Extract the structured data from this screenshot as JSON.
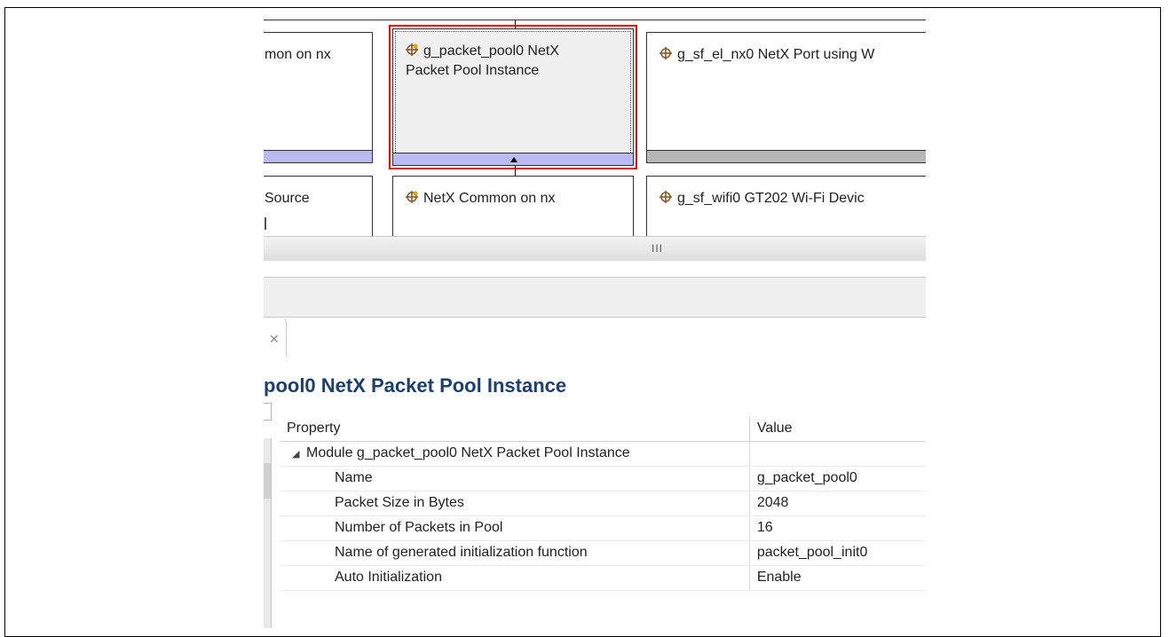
{
  "diagram": {
    "modules": [
      {
        "id": "common-top",
        "label": "mon on nx",
        "icon": "module-icon"
      },
      {
        "id": "packet-pool",
        "label": "g_packet_pool0 NetX\nPacket Pool Instance",
        "icon": "module-warning-icon",
        "selected": true
      },
      {
        "id": "port-nx",
        "label": "g_sf_el_nx0 NetX Port using W",
        "icon": "module-icon"
      },
      {
        "id": "source",
        "label": "Source",
        "icon": "none"
      },
      {
        "id": "common-bottom",
        "label": "NetX Common on nx",
        "icon": "module-warning-icon"
      },
      {
        "id": "wifi",
        "label": "g_sf_wifi0 GT202 Wi-Fi Devic",
        "icon": "module-icon"
      }
    ],
    "scroll_grip": "III"
  },
  "properties": {
    "close_icon": "✕",
    "title": "pool0 NetX Packet Pool Instance",
    "columns": {
      "property": "Property",
      "value": "Value"
    },
    "group": "Module g_packet_pool0 NetX Packet Pool Instance",
    "rows": [
      {
        "property": "Name",
        "value": "g_packet_pool0"
      },
      {
        "property": "Packet Size in Bytes",
        "value": "2048"
      },
      {
        "property": "Number of Packets in Pool",
        "value": "16"
      },
      {
        "property": "Name of generated initialization function",
        "value": "packet_pool_init0"
      },
      {
        "property": "Auto Initialization",
        "value": "Enable"
      }
    ]
  },
  "colors": {
    "highlight": "#e00000",
    "title_blue": "#1d3f6b",
    "bar_blue": "#b9b9f4",
    "bar_grey": "#b7b7b7"
  }
}
